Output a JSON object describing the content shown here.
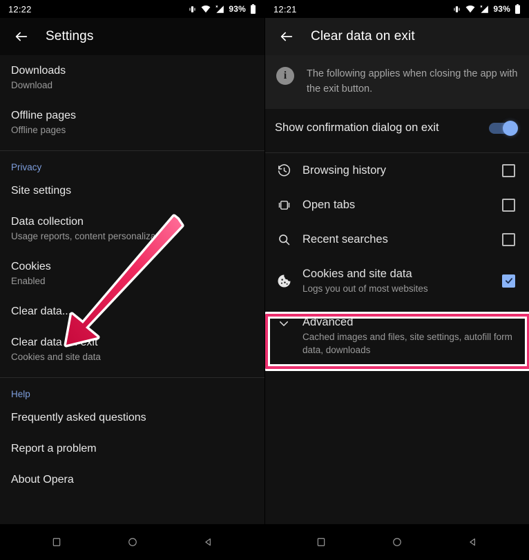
{
  "left_phone": {
    "status": {
      "time": "12:22",
      "battery_text": "93%",
      "icons": [
        "vibrate-icon",
        "wifi-icon",
        "signal-icon",
        "battery-icon"
      ]
    },
    "toolbar": {
      "back_icon": "arrow-left-icon",
      "title": "Settings"
    },
    "items": [
      {
        "title": "Downloads",
        "sub": "Download"
      },
      {
        "title": "Offline pages",
        "sub": "Offline pages"
      }
    ],
    "privacy_section": {
      "header": "Privacy",
      "items": [
        {
          "title": "Site settings",
          "sub": ""
        },
        {
          "title": "Data collection",
          "sub": "Usage reports, content personalization"
        },
        {
          "title": "Cookies",
          "sub": "Enabled"
        },
        {
          "title": "Clear data...",
          "sub": ""
        },
        {
          "title": "Clear data on exit",
          "sub": "Cookies and site data"
        }
      ]
    },
    "help_section": {
      "header": "Help",
      "items": [
        {
          "title": "Frequently asked questions",
          "sub": ""
        },
        {
          "title": "Report a problem",
          "sub": ""
        },
        {
          "title": "About Opera",
          "sub": ""
        }
      ]
    }
  },
  "right_phone": {
    "status": {
      "time": "12:21",
      "battery_text": "93%",
      "icons": [
        "vibrate-icon",
        "wifi-icon",
        "signal-icon",
        "battery-icon"
      ]
    },
    "toolbar": {
      "back_icon": "arrow-left-icon",
      "title": "Clear data on exit"
    },
    "info_banner": {
      "icon": "info-icon",
      "text": "The following applies when closing the app with the exit button."
    },
    "toggle": {
      "label": "Show confirmation dialog on exit",
      "state": "on"
    },
    "checkboxes": [
      {
        "icon": "history-icon",
        "title": "Browsing history",
        "sub": "",
        "checked": false
      },
      {
        "icon": "tabs-icon",
        "title": "Open tabs",
        "sub": "",
        "checked": false
      },
      {
        "icon": "search-icon",
        "title": "Recent searches",
        "sub": "",
        "checked": false
      },
      {
        "icon": "cookie-icon",
        "title": "Cookies and site data",
        "sub": "Logs you out of most websites",
        "checked": true
      }
    ],
    "advanced": {
      "icon": "chevron-down-icon",
      "title": "Advanced",
      "sub": "Cached images and files, site settings, autofill form data, downloads"
    }
  },
  "navbar": {
    "buttons": [
      "recents-square-icon",
      "home-circle-icon",
      "back-triangle-icon"
    ]
  },
  "annotation": {
    "arrow_color_start": "#ff5f8d",
    "arrow_color_end": "#d0093e",
    "arrow_outline": "#ffffff",
    "highlight_color": "#ec2f6e"
  }
}
